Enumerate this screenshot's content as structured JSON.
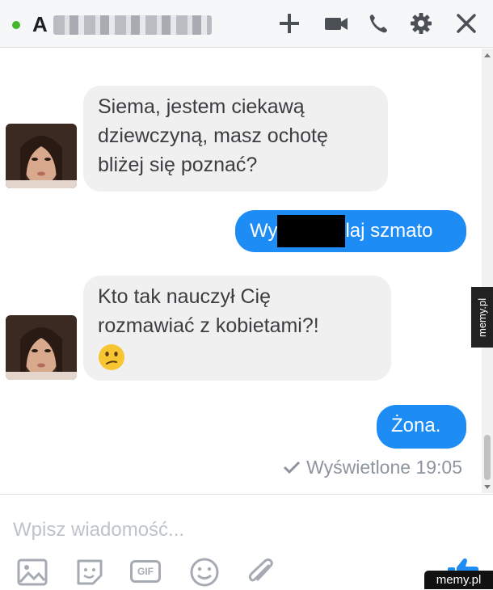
{
  "header": {
    "name_initial": "A",
    "add_icon": "plus-icon",
    "video_icon": "video-camera-icon",
    "call_icon": "phone-icon",
    "settings_icon": "gear-icon",
    "close_icon": "close-icon"
  },
  "messages": [
    {
      "from": "contact",
      "lines": [
        "Siema, jestem ciekawą",
        "dziewczyną, masz ochotę",
        "bliżej się poznać?"
      ]
    },
    {
      "from": "me",
      "text_before": "Wy",
      "text_after": "laj szmato"
    },
    {
      "from": "contact",
      "lines": [
        "Kto tak nauczył Cię",
        "rozmawiać z kobietami?!"
      ],
      "emoji": "confused-face-emoji"
    },
    {
      "from": "me",
      "text": "Żona."
    }
  ],
  "seen": {
    "text": "Wyświetlone 19:05"
  },
  "composer": {
    "placeholder": "Wpisz wiadomość...",
    "gif_label": "GIF",
    "icons": [
      "image-icon",
      "sticker-icon",
      "gif-icon",
      "emoji-icon",
      "attachment-icon",
      "thumbs-up-icon"
    ]
  },
  "watermarks": {
    "side": "memy.pl",
    "bottom": "memy.pl"
  },
  "colors": {
    "accent": "#1d8cf4",
    "incoming_bubble": "#f1f0f0",
    "online": "#42b72a"
  }
}
